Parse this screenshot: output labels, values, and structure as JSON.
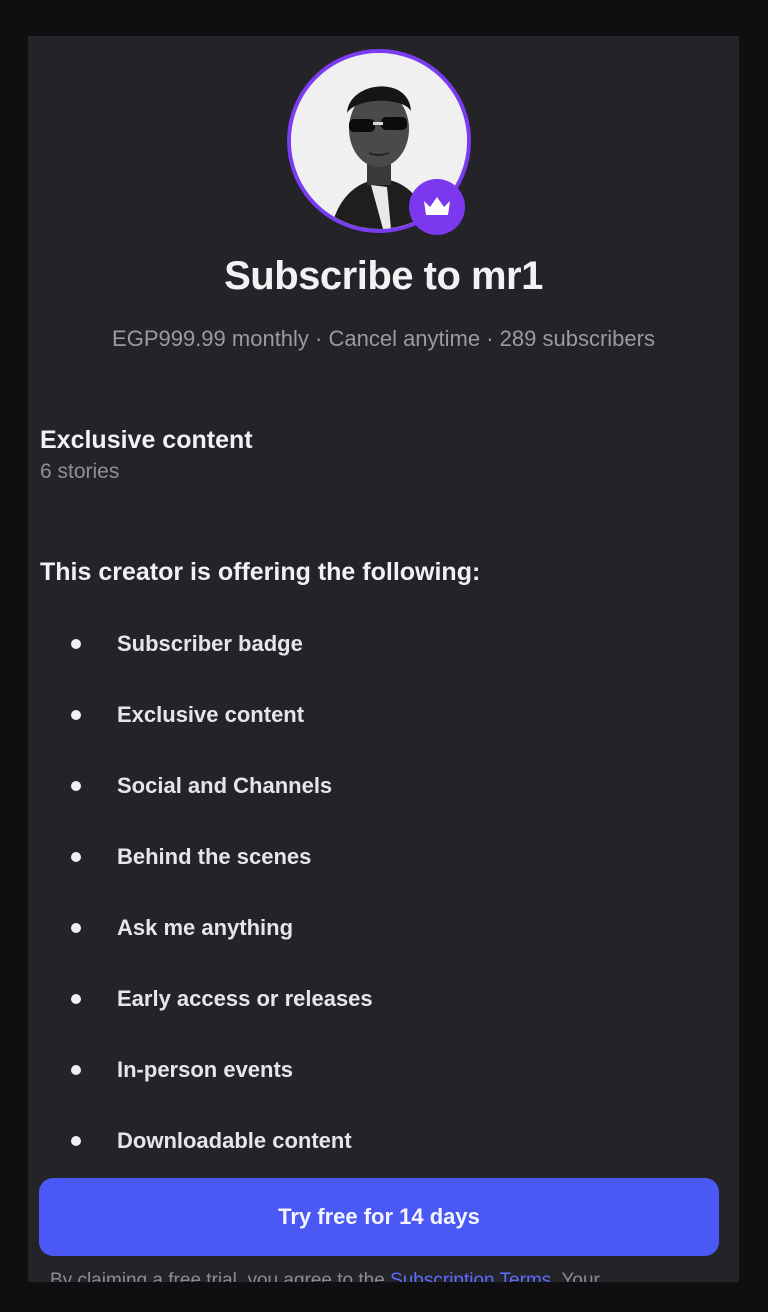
{
  "colors": {
    "background": "#232328",
    "accent_purple": "#7b38ee",
    "cta_blue": "#4a58f6",
    "link_blue": "#5d6bff"
  },
  "header": {
    "avatar_icon": "creator-avatar",
    "badge_icon": "crown-icon",
    "title": "Subscribe to mr1",
    "meta": "EGP999.99 monthly · Cancel anytime · 289 subscribers"
  },
  "exclusive": {
    "title": "Exclusive content",
    "count": "6 stories"
  },
  "offer": {
    "heading": "This creator is offering the following:",
    "items": [
      "Subscriber badge",
      "Exclusive content",
      "Social and Channels",
      "Behind the scenes",
      "Ask me anything",
      "Early access or releases",
      "In-person events",
      "Downloadable content"
    ]
  },
  "cta": {
    "label": "Try free for 14 days"
  },
  "legal": {
    "prefix": "By claiming a free trial, you agree to the ",
    "link": "Subscription Terms",
    "suffix": ". Your"
  }
}
